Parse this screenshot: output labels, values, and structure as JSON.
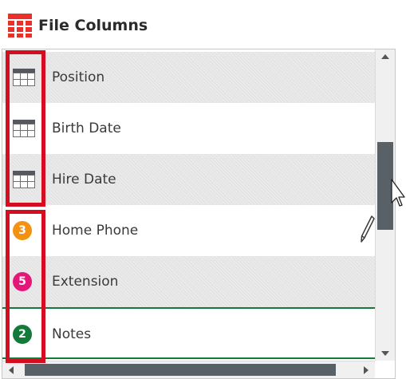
{
  "header": {
    "title": "File Columns",
    "icon": "table-grid-icon",
    "icon_color": "#e8312b"
  },
  "rows": [
    {
      "label": "Position",
      "icon": "table-column-icon",
      "shade": true
    },
    {
      "label": "Birth Date",
      "icon": "table-column-icon",
      "shade": false
    },
    {
      "label": "Hire Date",
      "icon": "table-column-icon",
      "shade": true
    },
    {
      "label": "Home Phone",
      "badge": "3",
      "badge_color": "#f29112",
      "shade": false
    },
    {
      "label": "Extension",
      "badge": "5",
      "badge_color": "#e6157a",
      "shade": true
    },
    {
      "label": "Notes",
      "badge": "2",
      "badge_color": "#137a3a",
      "shade": false
    }
  ],
  "colors": {
    "highlight": "#d40d20",
    "selected_line": "#137a3a",
    "scroll_thumb": "#596066"
  }
}
